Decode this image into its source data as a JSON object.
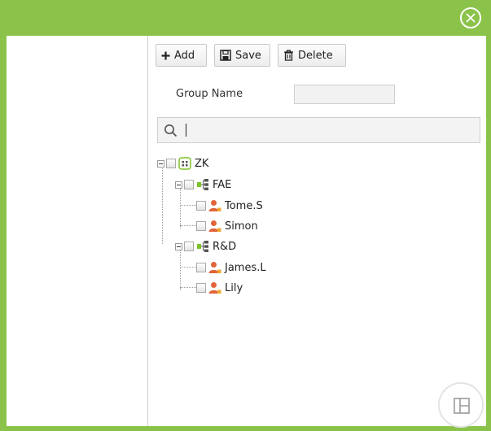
{
  "toolbar": {
    "add_label": "Add",
    "save_label": "Save",
    "delete_label": "Delete"
  },
  "form": {
    "group_name_label": "Group Name",
    "group_name_value": ""
  },
  "search": {
    "value": ""
  },
  "tree": {
    "root": {
      "label": "ZK",
      "icon": "org-icon"
    },
    "groups": [
      {
        "label": "FAE",
        "icon": "dept-icon",
        "members": [
          {
            "label": "Tome.S",
            "icon": "user-icon"
          },
          {
            "label": "Simon",
            "icon": "user-icon"
          }
        ]
      },
      {
        "label": "R&D",
        "icon": "dept-icon",
        "members": [
          {
            "label": "James.L",
            "icon": "user-icon"
          },
          {
            "label": "Lily",
            "icon": "user-icon"
          }
        ]
      }
    ]
  },
  "colors": {
    "titlebar": "#8bc34a",
    "accent_green": "#7cc42a",
    "user_icon": "#e0643a"
  }
}
